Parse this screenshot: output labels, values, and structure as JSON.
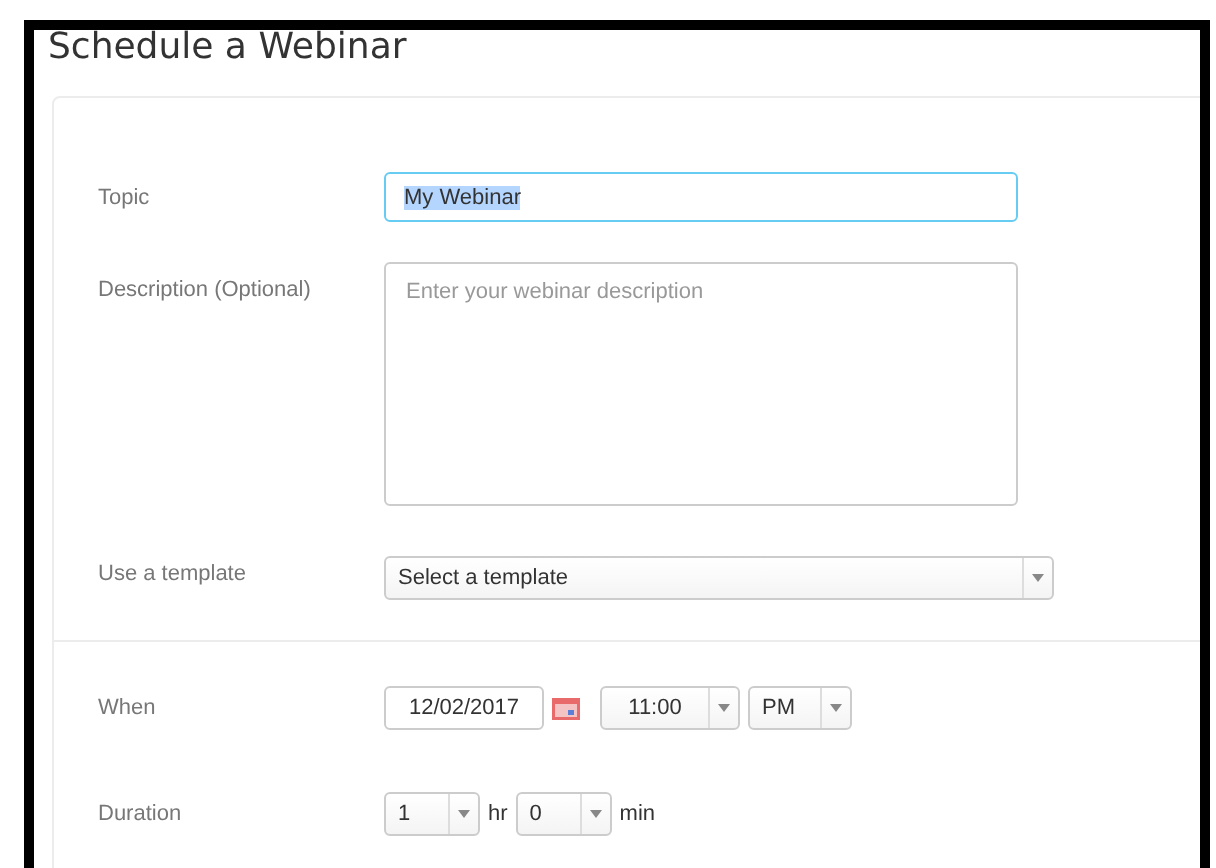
{
  "title": "Schedule a Webinar",
  "topic": {
    "label": "Topic",
    "value": "My Webinar",
    "focused": true,
    "text_selected": true
  },
  "description": {
    "label": "Description (Optional)",
    "placeholder": "Enter your webinar description"
  },
  "template": {
    "label": "Use a template",
    "value": "Select a template"
  },
  "when": {
    "label": "When",
    "date": "12/02/2017",
    "time": "11:00",
    "ampm": "PM"
  },
  "duration": {
    "label": "Duration",
    "hours": "1",
    "hours_unit": "hr",
    "minutes": "0",
    "minutes_unit": "min"
  }
}
